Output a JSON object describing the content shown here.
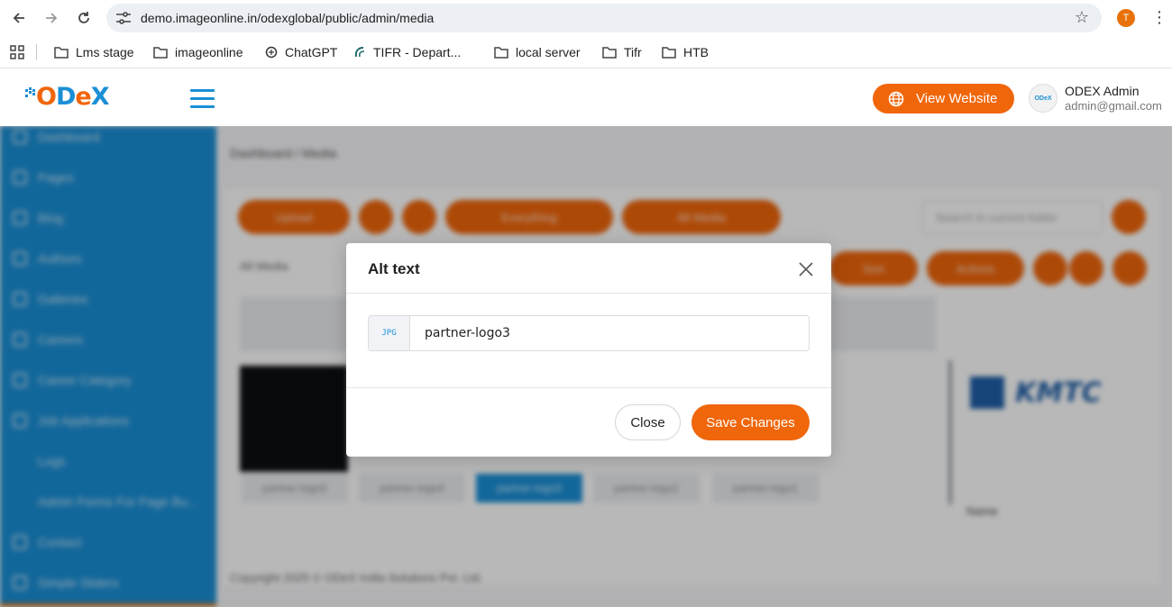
{
  "browser": {
    "url": "demo.imageonline.in/odexglobal/public/admin/media",
    "profile_initial": "T",
    "bookmarks": [
      {
        "label": "Lms stage",
        "icon": "folder-icon"
      },
      {
        "label": "imageonline",
        "icon": "folder-icon"
      },
      {
        "label": "ChatGPT",
        "icon": "chatgpt-icon"
      },
      {
        "label": "TIFR - Depart...",
        "icon": "tifr-icon"
      },
      {
        "label": "local server",
        "icon": "folder-icon"
      },
      {
        "label": "Tifr",
        "icon": "folder-icon"
      },
      {
        "label": "HTB",
        "icon": "folder-icon"
      }
    ]
  },
  "header": {
    "logo_text": "ODeX",
    "view_website_label": "View Website",
    "avatar_text": "ODeX",
    "user_name": "ODEX Admin",
    "user_email": "admin@gmail.com"
  },
  "sidebar": {
    "items": [
      "Dashboard",
      "Pages",
      "Blog",
      "Authors",
      "Galleries",
      "Careers",
      "Career Category",
      "Job Applications",
      "Logs",
      "Admin Forms For Page Bu...",
      "Contact",
      "Simple Sliders"
    ]
  },
  "main": {
    "breadcrumb": "Dashboard / Media",
    "toolbar": {
      "upload_label": "Upload",
      "filter_label": "Everything",
      "view_label": "All Media",
      "search_placeholder": "Search in current folder",
      "all_media_label": "All Media",
      "sort_label": "Sort",
      "actions_label": "Actions"
    },
    "thumbnails": [
      "partner-logo5",
      "partner-logo4",
      "partner-logo3",
      "partner-logo2",
      "partner-logo1"
    ],
    "detail_label": "Name",
    "copyright": "Copyright 2025 © ODeX India Solutions Pvt. Ltd."
  },
  "modal": {
    "title": "Alt text",
    "file_type": "JPG",
    "alt_value": "partner-logo3",
    "close_label": "Close",
    "save_label": "Save Changes"
  },
  "colors": {
    "accent": "#f0660b",
    "brand_blue": "#1a8fd6"
  }
}
